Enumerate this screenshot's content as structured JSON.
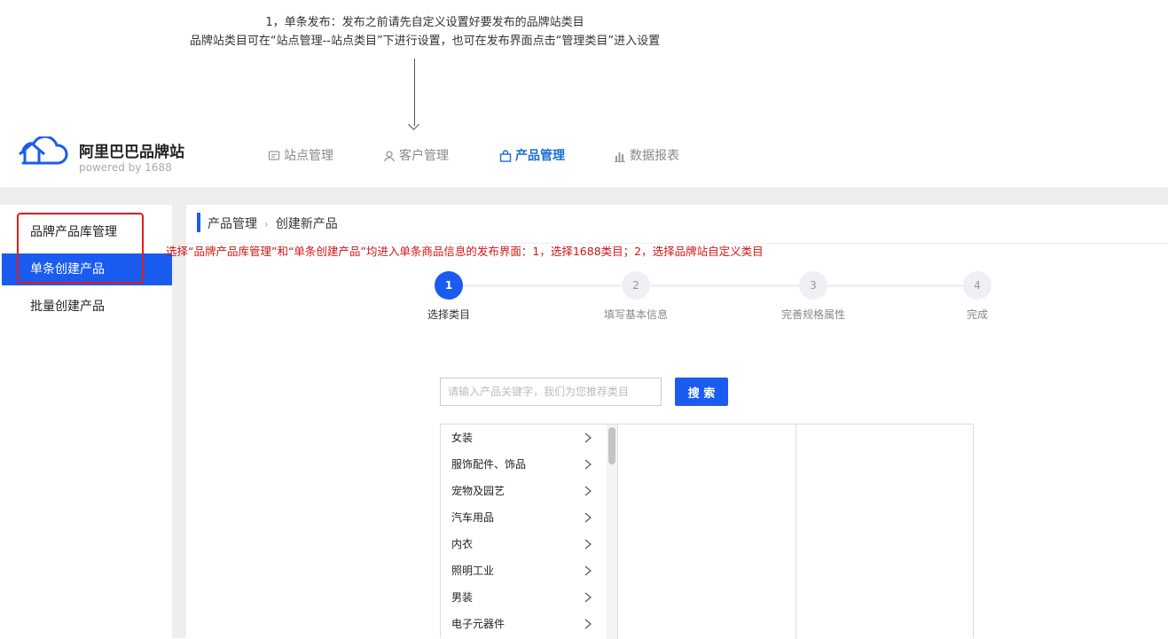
{
  "annotation": {
    "line1": "1，单条发布：发布之前请先自定义设置好要发布的品牌站类目",
    "line2": "品牌站类目可在“站点管理--站点类目”下进行设置，也可在发布界面点击“管理类目”进入设置"
  },
  "brand": {
    "title": "阿里巴巴品牌站",
    "subtitle": "powered by 1688"
  },
  "nav": [
    {
      "label": "站点管理",
      "icon": "site-icon",
      "active": false
    },
    {
      "label": "客户管理",
      "icon": "user-icon",
      "active": false
    },
    {
      "label": "产品管理",
      "icon": "bag-icon",
      "active": true
    },
    {
      "label": "数据报表",
      "icon": "bar-chart-icon",
      "active": false
    }
  ],
  "sidebar": {
    "items": [
      {
        "label": "品牌产品库管理",
        "active": false
      },
      {
        "label": "单条创建产品",
        "active": true
      },
      {
        "label": "批量创建产品",
        "active": false
      }
    ]
  },
  "breadcrumb": {
    "parent": "产品管理",
    "current": "创建新产品"
  },
  "red_note": "选择“品牌产品库管理”和“单条创建产品”均进入单条商品信息的发布界面：1，选择1688类目；2，选择品牌站自定义类目",
  "steps": [
    {
      "num": "1",
      "label": "选择类目",
      "done": true
    },
    {
      "num": "2",
      "label": "填写基本信息",
      "done": false
    },
    {
      "num": "3",
      "label": "完善规格属性",
      "done": false
    },
    {
      "num": "4",
      "label": "完成",
      "done": false
    }
  ],
  "search": {
    "placeholder": "请输入产品关键字，我们为您推荐类目",
    "button": "搜 索"
  },
  "categories": [
    "女装",
    "服饰配件、饰品",
    "宠物及园艺",
    "汽车用品",
    "内衣",
    "照明工业",
    "男装",
    "电子元器件"
  ],
  "colors": {
    "accent": "#1a5cf0",
    "annotation_red": "#d01515"
  }
}
